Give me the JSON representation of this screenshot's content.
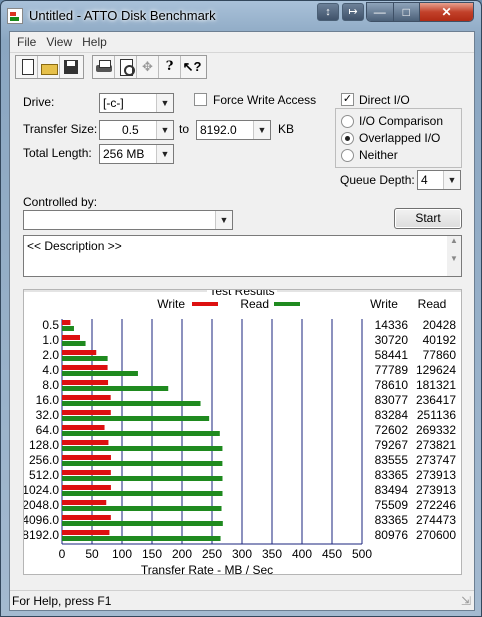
{
  "window": {
    "title": "Untitled - ATTO Disk Benchmark",
    "extra_buttons": [
      "↕",
      "↦"
    ]
  },
  "menu": [
    "File",
    "View",
    "Help"
  ],
  "toolbar": {
    "tools": [
      "new-icon",
      "open-icon",
      "save-icon",
      "print-icon",
      "print-preview-icon",
      "move-icon",
      "help-icon",
      "context-help-icon"
    ]
  },
  "settings": {
    "drive_label": "Drive:",
    "drive_value": "[-c-]",
    "force_write_label": "Force Write Access",
    "force_write_checked": false,
    "direct_io_label": "Direct I/O",
    "direct_io_checked": true,
    "transfer_size_label": "Transfer Size:",
    "transfer_from": "0.5",
    "to_label": "to",
    "transfer_to": "8192.0",
    "kb_label": "KB",
    "total_length_label": "Total Length:",
    "total_length_value": "256 MB",
    "io_options": [
      "I/O Comparison",
      "Overlapped I/O",
      "Neither"
    ],
    "io_selected": 1,
    "queue_depth_label": "Queue Depth:",
    "queue_depth_value": "4",
    "controlled_by_label": "Controlled by:",
    "controlled_by_value": "",
    "start_label": "Start",
    "description": "<< Description >>"
  },
  "colors": {
    "write": "#dd1010",
    "read": "#1f8a1f",
    "grid": "#1a237e"
  },
  "chart_data": {
    "type": "bar",
    "title": "Test Results",
    "xlabel": "Transfer Rate - MB / Sec",
    "xlim": [
      0,
      500
    ],
    "x_ticks": [
      "0",
      "50",
      "100",
      "150",
      "200",
      "250",
      "300",
      "350",
      "400",
      "450",
      "500"
    ],
    "categories": [
      "0.5",
      "1.0",
      "2.0",
      "4.0",
      "8.0",
      "16.0",
      "32.0",
      "64.0",
      "128.0",
      "256.0",
      "512.0",
      "1024.0",
      "2048.0",
      "4096.0",
      "8192.0"
    ],
    "series": [
      {
        "name": "Write",
        "values": [
          14336,
          30720,
          58441,
          77789,
          78610,
          83077,
          83284,
          72602,
          79267,
          83555,
          83365,
          83494,
          75509,
          83365,
          80976
        ]
      },
      {
        "name": "Read",
        "values": [
          20428,
          40192,
          77860,
          129624,
          181321,
          236417,
          251136,
          269332,
          273821,
          273747,
          273913,
          273913,
          272246,
          274473,
          270600
        ]
      }
    ],
    "value_columns": [
      "Write",
      "Read"
    ],
    "legend": "top"
  },
  "status": {
    "text": "For Help, press F1"
  }
}
